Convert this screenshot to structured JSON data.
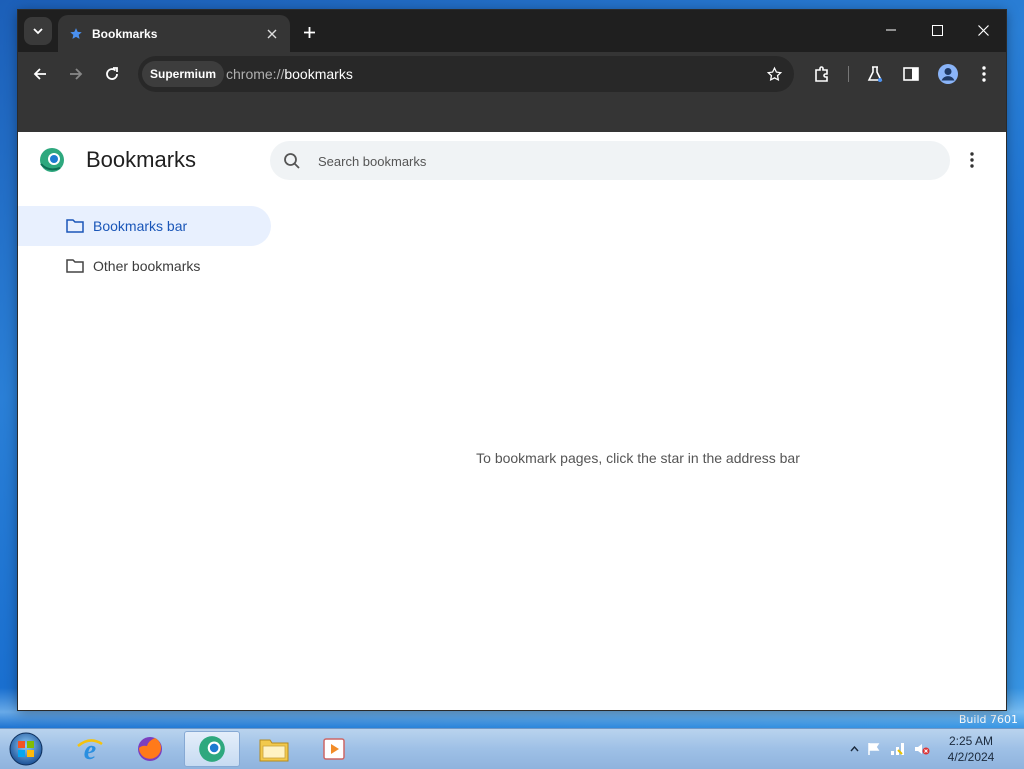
{
  "desktop": {
    "build_text": "Build 7601"
  },
  "browser": {
    "tab_title": "Bookmarks",
    "url_chip": "Supermium",
    "url_scheme": "chrome://",
    "url_path": "bookmarks"
  },
  "page": {
    "title": "Bookmarks",
    "search_placeholder": "Search bookmarks",
    "nav_items": [
      {
        "label": "Bookmarks bar",
        "selected": true
      },
      {
        "label": "Other bookmarks",
        "selected": false
      }
    ],
    "empty_message": "To bookmark pages, click the star in the address bar"
  },
  "taskbar": {
    "apps": [
      "internet-explorer",
      "firefox",
      "supermium",
      "file-explorer",
      "media-player"
    ],
    "time": "2:25 AM",
    "date": "4/2/2024"
  },
  "colors": {
    "accent": "#1a73e8",
    "selected_bg": "#e8f0fe",
    "titlebar": "#1f1f1f",
    "toolbar": "#353535"
  }
}
